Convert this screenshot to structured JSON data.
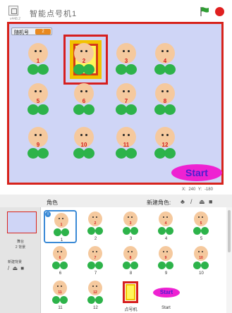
{
  "window": {
    "title": "智能点号机1",
    "version": "v448.2",
    "flag_color": "#2f9e33",
    "stop_color": "#e02020"
  },
  "stage": {
    "variable": {
      "label": "随机号",
      "value": "2"
    },
    "faces": [
      {
        "num": "1"
      },
      {
        "num": "2"
      },
      {
        "num": "3"
      },
      {
        "num": "4"
      },
      {
        "num": "5"
      },
      {
        "num": "6"
      },
      {
        "num": "7"
      },
      {
        "num": "8"
      },
      {
        "num": "9"
      },
      {
        "num": "10"
      },
      {
        "num": "11"
      },
      {
        "num": "12"
      }
    ],
    "start_label": "Start"
  },
  "info": {
    "x_label": "X:",
    "x_value": "240",
    "y_label": "Y:",
    "y_value": "-180"
  },
  "sprites_panel": {
    "title": "角色",
    "new_sprite_label": "新建角色:",
    "new_sprite_icons": [
      "character-icon",
      "paint-icon",
      "upload-icon",
      "camera-icon"
    ],
    "stage_label": "舞台",
    "backdrop_count": "2 背景",
    "new_backdrop_label": "新建背景",
    "backdrop_icons": [
      "paint-icon",
      "upload-icon",
      "camera-icon"
    ],
    "items": [
      {
        "label": "1",
        "num": "1",
        "kind": "face"
      },
      {
        "label": "2",
        "num": "2",
        "kind": "face"
      },
      {
        "label": "3",
        "num": "3",
        "kind": "face"
      },
      {
        "label": "4",
        "num": "4",
        "kind": "face"
      },
      {
        "label": "5",
        "num": "5",
        "kind": "face"
      },
      {
        "label": "6",
        "num": "6",
        "kind": "face"
      },
      {
        "label": "7",
        "num": "7",
        "kind": "face"
      },
      {
        "label": "8",
        "num": "8",
        "kind": "face"
      },
      {
        "label": "9",
        "num": "9",
        "kind": "face"
      },
      {
        "label": "10",
        "num": "10",
        "kind": "face"
      },
      {
        "label": "11",
        "num": "11",
        "kind": "face"
      },
      {
        "label": "12",
        "num": "12",
        "kind": "face"
      },
      {
        "label": "点号机",
        "kind": "frame"
      },
      {
        "label": "Start",
        "kind": "button",
        "text": "Start"
      }
    ]
  }
}
